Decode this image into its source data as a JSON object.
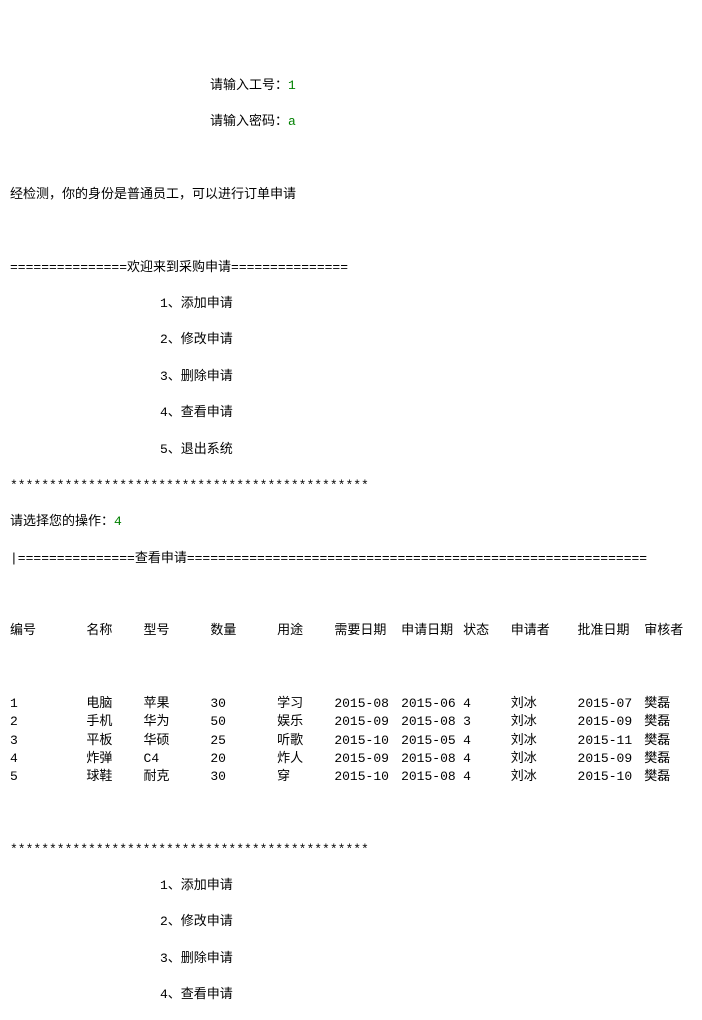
{
  "prompts": {
    "emp_id_label": "请输入工号：",
    "emp_id_value": "1",
    "password_label": "请输入密码：",
    "password_value": "a"
  },
  "identity_msg": "经检测，你的身份是普通员工，可以进行订单申请",
  "welcome_banner": "===============欢迎来到采购申请===============",
  "menu": {
    "items": [
      "1、添加申请",
      "2、修改申请",
      "3、删除申请",
      "4、查看申请",
      "5、退出系统"
    ]
  },
  "stars_line": "**********************************************",
  "op_prompt": "请选择您的操作：",
  "op_value": "4",
  "view_banner": "|===============查看申请===========================================================",
  "headers": {
    "c0": "编号",
    "c1": "名称",
    "c2": "型号",
    "c3": "数量",
    "c4": "用途",
    "c5": "需要日期",
    "c6": "申请日期",
    "c7": "状态",
    "c8": "申请者",
    "c9": "批准日期",
    "c10": "审核者"
  },
  "rows": [
    {
      "c0": "1",
      "c1": "电脑",
      "c2": "苹果",
      "c3": "30",
      "c4": "学习",
      "c5": "2015-08",
      "c6": "2015-06",
      "c7": "4",
      "c8": "刘冰",
      "c9": "2015-07",
      "c10": "樊磊"
    },
    {
      "c0": "2",
      "c1": "手机",
      "c2": "华为",
      "c3": "50",
      "c4": "娱乐",
      "c5": "2015-09",
      "c6": "2015-08",
      "c7": "3",
      "c8": "刘冰",
      "c9": "2015-09",
      "c10": "樊磊"
    },
    {
      "c0": "3",
      "c1": "平板",
      "c2": "华硕",
      "c3": "25",
      "c4": "听歌",
      "c5": "2015-10",
      "c6": "2015-05",
      "c7": "4",
      "c8": "刘冰",
      "c9": "2015-11",
      "c10": "樊磊"
    },
    {
      "c0": "4",
      "c1": "炸弹",
      "c2": "C4",
      "c3": "20",
      "c4": "炸人",
      "c5": "2015-09",
      "c6": "2015-08",
      "c7": "4",
      "c8": "刘冰",
      "c9": "2015-09",
      "c10": "樊磊"
    },
    {
      "c0": "5",
      "c1": "球鞋",
      "c2": "耐克",
      "c3": "30",
      "c4": "穿",
      "c5": "2015-10",
      "c6": "2015-08",
      "c7": "4",
      "c8": "刘冰",
      "c9": "2015-10",
      "c10": "樊磊"
    }
  ],
  "menu2": {
    "items": [
      "1、添加申请",
      "2、修改申请",
      "3、删除申请",
      "4、查看申请"
    ]
  }
}
